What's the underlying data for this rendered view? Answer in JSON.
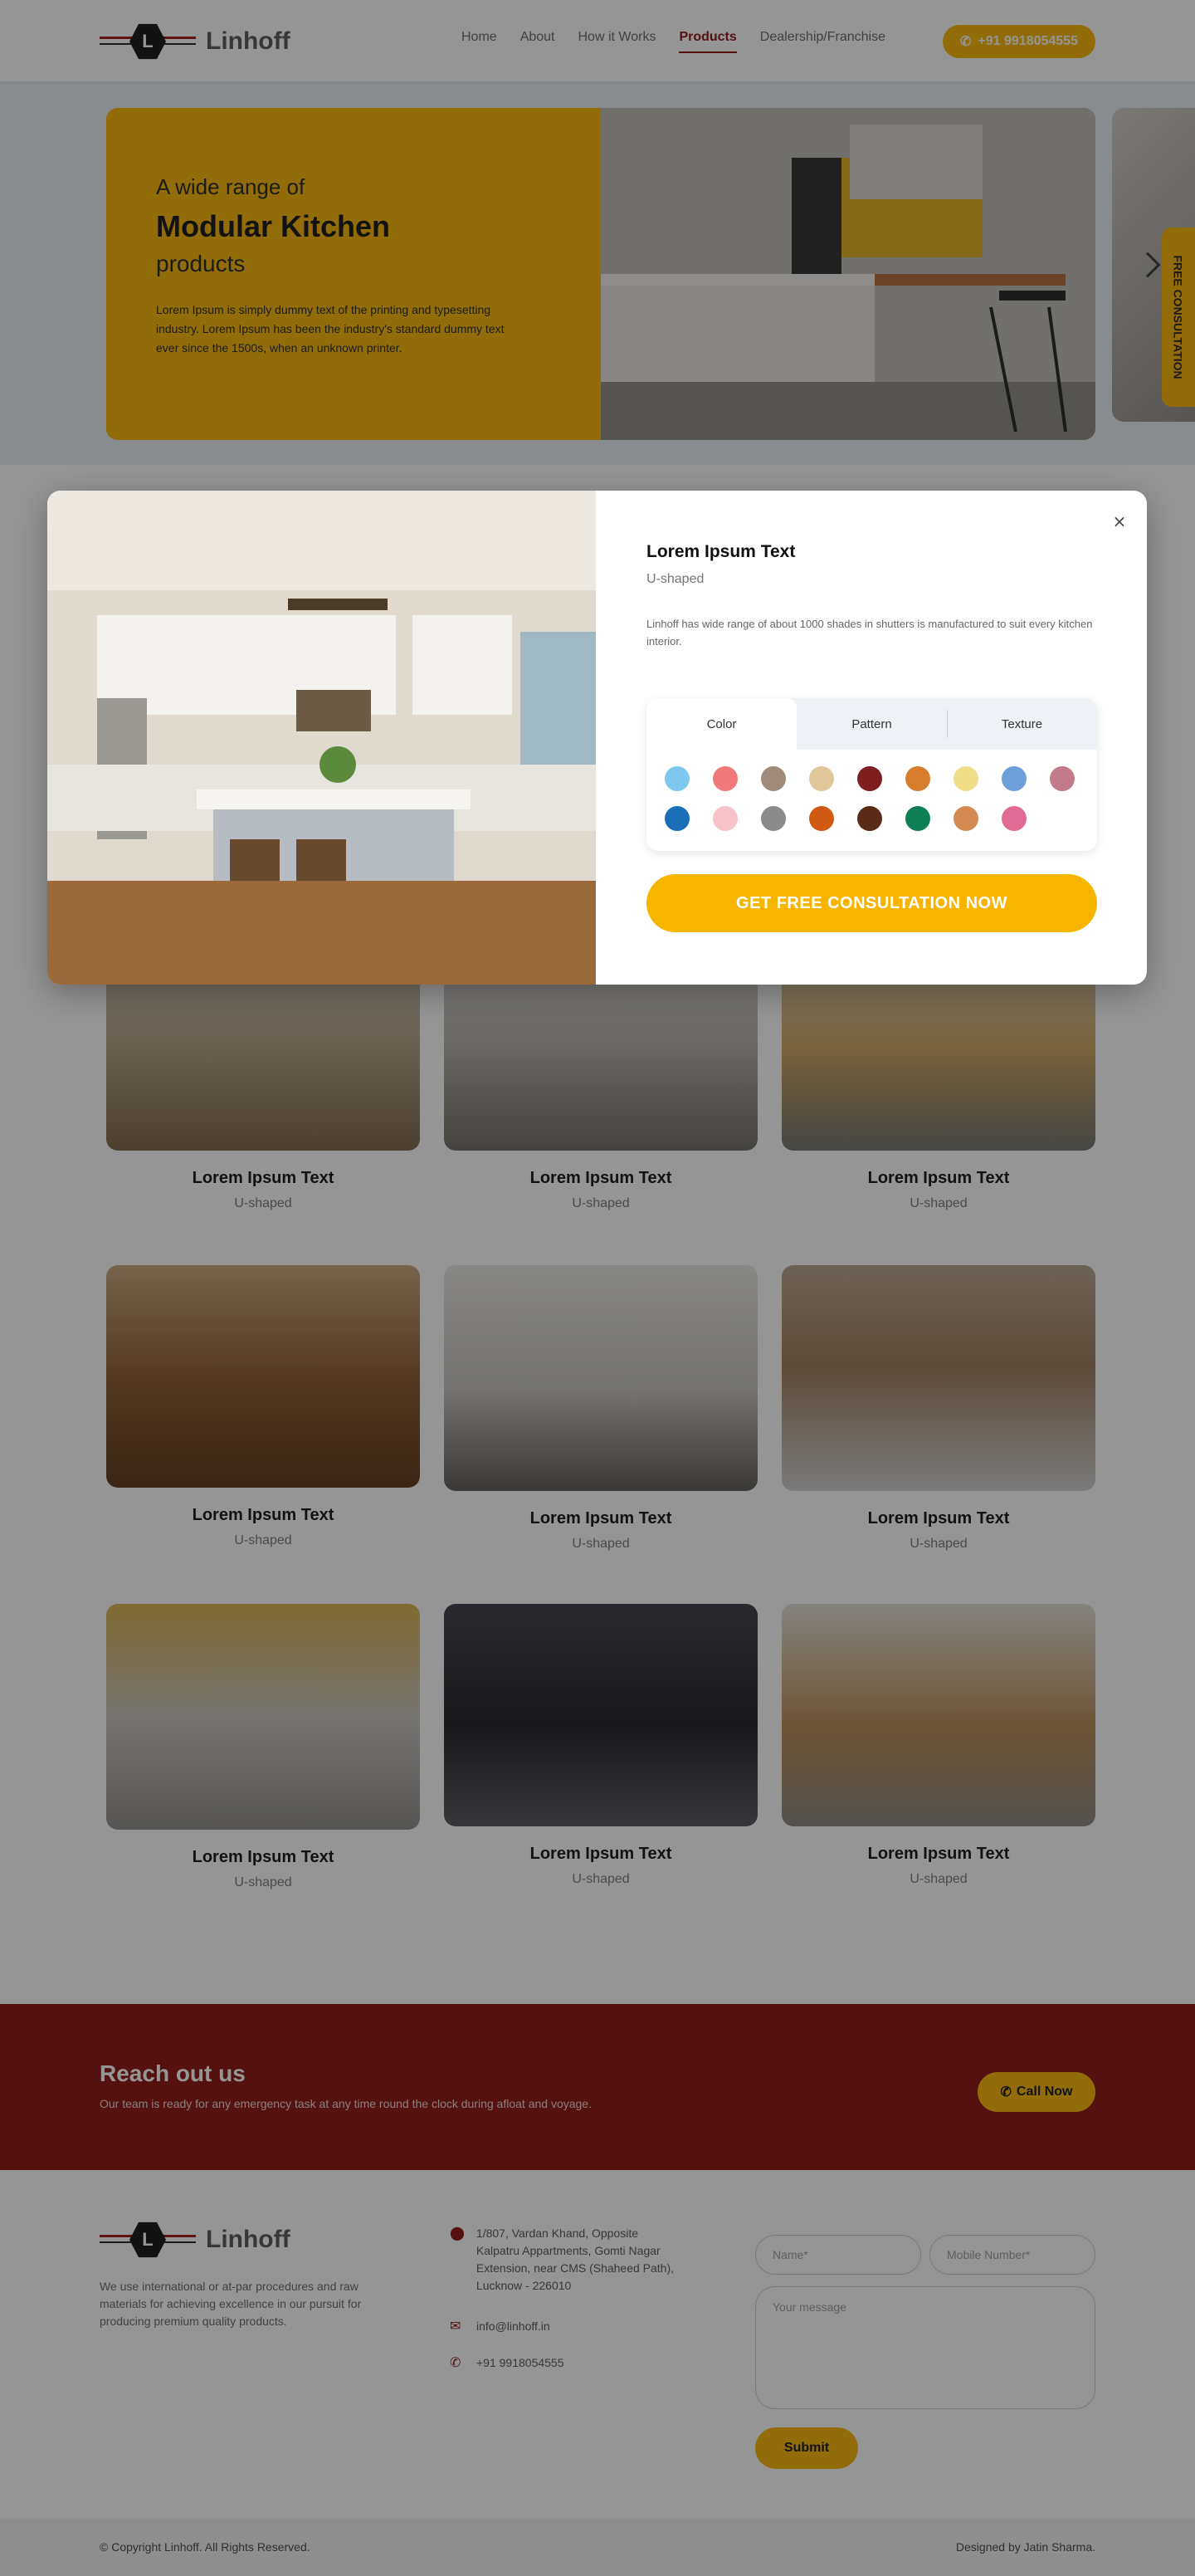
{
  "header": {
    "logo_letter": "L",
    "logo_text": "Linhoff",
    "nav": [
      "Home",
      "About",
      "How it Works",
      "Products",
      "Dealership/Franchise"
    ],
    "active_nav": "Products",
    "phone": "+91 9918054555"
  },
  "hero": {
    "line1": "A wide range of",
    "line2": "Modular Kitchen",
    "line3": "products",
    "description": "Lorem Ipsum is simply dummy text of the printing and typesetting industry. Lorem Ipsum has been the industry's standard dummy text ever since the 1500s, when an unknown printer.",
    "side_tab": "FREE CONSULTATION"
  },
  "modal": {
    "title": "Lorem Ipsum Text",
    "subtitle": "U-shaped",
    "description": "Linhoff has wide range of about 1000 shades in shutters is manufactured to suit every kitchen interior.",
    "tabs": [
      "Color",
      "Pattern",
      "Texture"
    ],
    "active_tab": "Color",
    "swatches_row1": [
      "#7fc8f0",
      "#f07a7a",
      "#a08a7a",
      "#e2c79a",
      "#7e1f1f",
      "#d67d2e",
      "#f0dd88",
      "#6d9fd8",
      "#c27a8a"
    ],
    "swatches_row2": [
      "#1a6fb8",
      "#f7c2c8",
      "#8a8a8a",
      "#d15a12",
      "#5a2b16",
      "#0f7f56",
      "#d48a52",
      "#e06a94"
    ],
    "cta": "GET FREE CONSULTATION NOW",
    "close_symbol": "×"
  },
  "products": [
    {
      "title": "Lorem Ipsum Text",
      "subtitle": "U-shaped"
    },
    {
      "title": "Lorem Ipsum Text",
      "subtitle": "U-shaped"
    },
    {
      "title": "Lorem Ipsum Text",
      "subtitle": "U-shaped"
    },
    {
      "title": "Lorem Ipsum Text",
      "subtitle": "U-shaped"
    },
    {
      "title": "Lorem Ipsum Text",
      "subtitle": "U-shaped"
    },
    {
      "title": "Lorem Ipsum Text",
      "subtitle": "U-shaped"
    },
    {
      "title": "Lorem Ipsum Text",
      "subtitle": "U-shaped"
    },
    {
      "title": "Lorem Ipsum Text",
      "subtitle": "U-shaped"
    },
    {
      "title": "Lorem Ipsum Text",
      "subtitle": "U-shaped"
    }
  ],
  "cta": {
    "title": "Reach out us",
    "subtitle": "Our team is ready for any emergency task at any time round the clock during afloat and voyage.",
    "button": "Call Now"
  },
  "footer": {
    "description": "We use international or at-par procedures and raw materials for achieving excellence in our pursuit for producing premium quality products.",
    "address": "1/807, Vardan Khand, Opposite Kalpatru Appartments, Gomti Nagar Extension, near CMS (Shaheed Path), Lucknow - 226010",
    "email": "info@linhoff.in",
    "phone": "+91 9918054555",
    "name_placeholder": "Name*",
    "mobile_placeholder": "Mobile Number*",
    "message_placeholder": "Your message",
    "submit": "Submit",
    "copyright": "© Copyright Linhoff. All Rights Reserved.",
    "credit": "Designed by Jatin Sharma."
  },
  "colors": {
    "accent": "#f7b500",
    "brand": "#8b0d0d"
  }
}
